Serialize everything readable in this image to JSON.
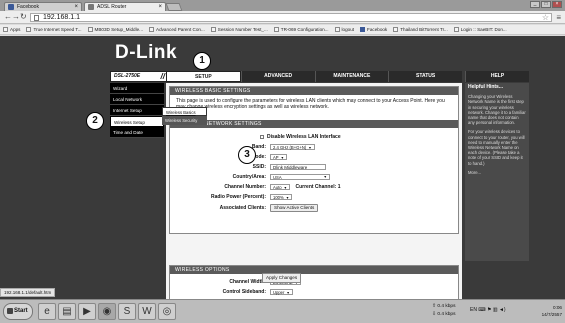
{
  "browser": {
    "tabs": [
      {
        "label": "Facebook"
      },
      {
        "label": "ADSL Router"
      }
    ],
    "address": "192.168.1.1",
    "bookmarks": [
      "Apps",
      "True Internet Speed T...",
      "MB03D Setup_Middle...",
      "Advanced Parent Con...",
      "Session Number Test_...",
      "TR-069 Configuration...",
      "logout",
      "Facebook",
      "Thailand BitTorrent Tr...",
      "Login :: SaeBIT: Don..."
    ],
    "status_url": "192.168.1.1/default.htm"
  },
  "router": {
    "logo": "D-Link",
    "model": "DSL-2750E",
    "nav": [
      "SETUP",
      "ADVANCED",
      "MAINTENANCE",
      "STATUS"
    ],
    "help_tab": "HELP",
    "sidebar": [
      "Wizard",
      "Local Network",
      "Internet Setup",
      "Wireless Setup",
      "Time and Date"
    ],
    "submenu": [
      "Wireless Basics",
      "Wireless Security"
    ],
    "basic": {
      "heading": "WIRELESS BASIC SETTINGS",
      "intro": "This page is used to configure the parameters for wireless LAN clients which may connect to your Access Point. Here you may change wireless encryption settings as well as wireless network.",
      "sub_heading": "WIRELESS NETWORK SETTINGS",
      "disable_label": "Disable Wireless LAN Interface",
      "band_label": "Band:",
      "band_value": "2.4 GHz (B+G+N)",
      "mode_label": "Mode:",
      "mode_value": "AP",
      "ssid_label": "SSID:",
      "ssid_value": "Dlink Middleware",
      "country_label": "Country/Area:",
      "country_value": "USA",
      "channel_label": "Channel Number:",
      "channel_value": "Auto",
      "current_channel": "Current Channel: 1",
      "power_label": "Radio Power (Percent):",
      "power_value": "100%",
      "clients_label": "Associated Clients:",
      "clients_button": "Show Active Clients"
    },
    "options": {
      "heading": "WIRELESS OPTIONS",
      "width_label": "Channel Width:",
      "width_value": "20/40MHZ",
      "sideband_label": "Control Sideband:",
      "sideband_value": "Upper"
    },
    "apply_button": "Apply Changes",
    "help": {
      "title": "Helpful Hints...",
      "p1": "Changing your Wireless Network Name is the first step in securing your wireless network. Change it to a familiar name that does not contain any personal information.",
      "p2": "For your wireless devices to connect to your router, you will need to manually enter the Wireless Network Name on each device. (Please take a note of your SSID and keep it to hand.)",
      "more": "More..."
    }
  },
  "markers": [
    "1",
    "2",
    "3"
  ],
  "taskbar": {
    "start": "Start",
    "net_up": "0.4 kbps",
    "net_down": "0.4 kbps",
    "lang": "EN",
    "time": "0:06",
    "date": "14/7/2557"
  }
}
